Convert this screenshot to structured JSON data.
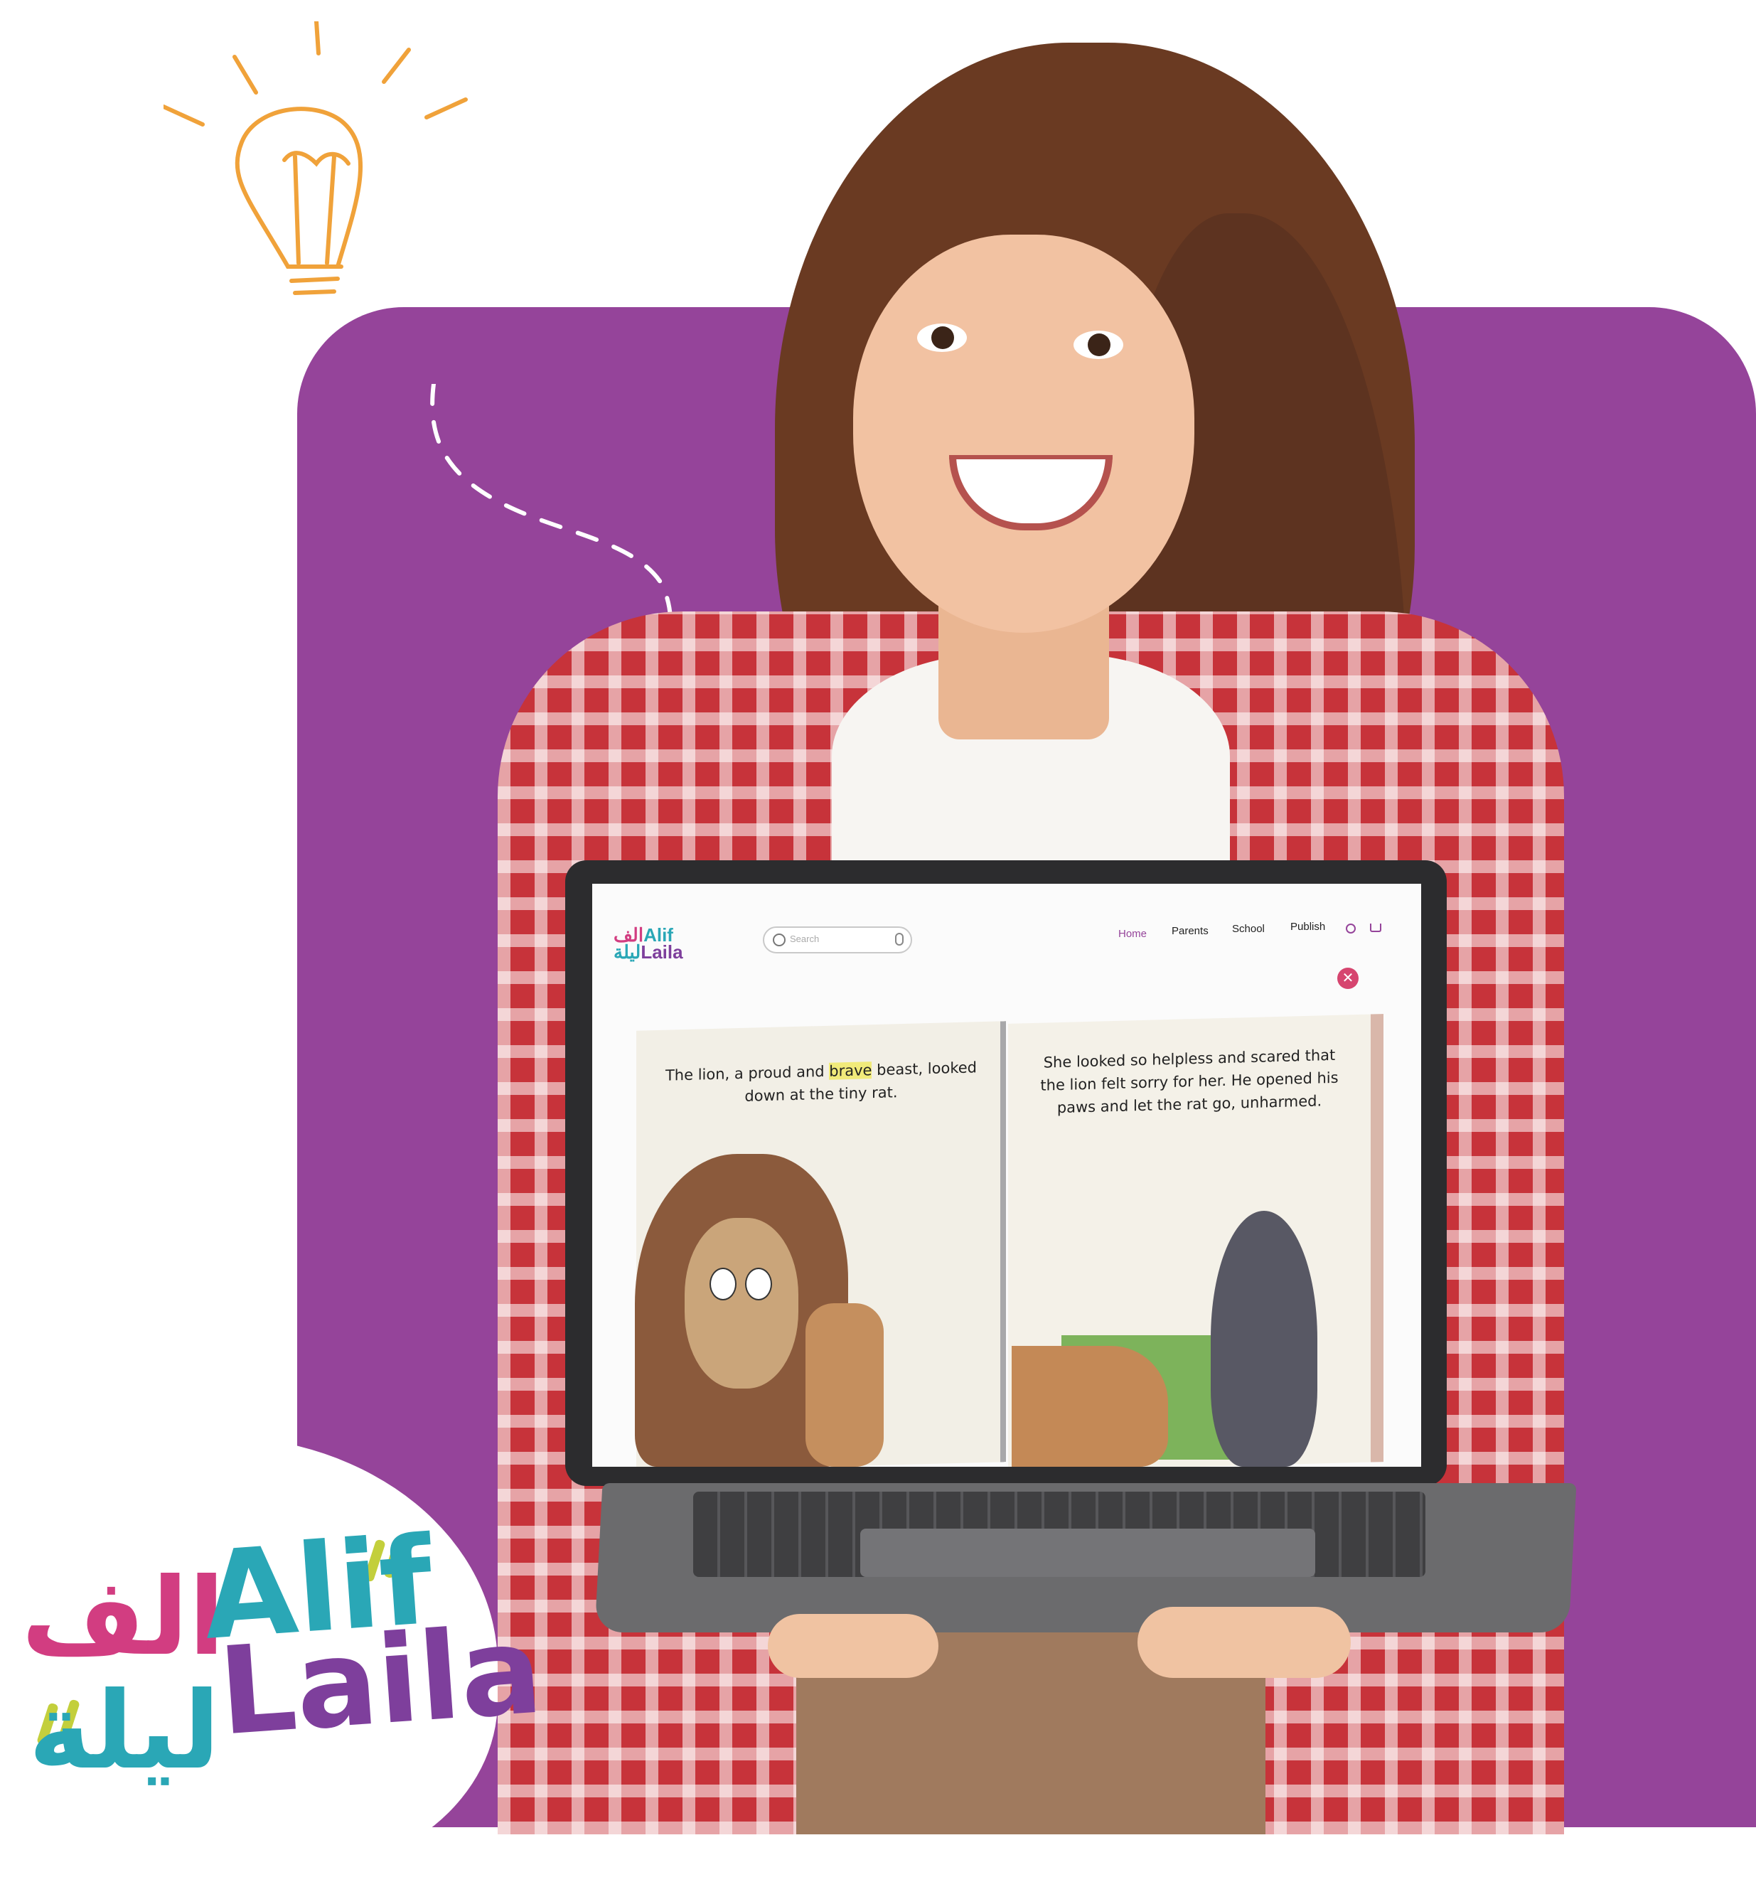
{
  "brand": {
    "latin_line1": "Alif",
    "latin_line2": "Laila",
    "arabic_line1": "الف",
    "arabic_line2": "ليلة",
    "colors": {
      "purple": "#95449a",
      "pink": "#d23d81",
      "teal": "#2aa7b6",
      "lime": "#c3cf3c"
    }
  },
  "screen": {
    "logo": {
      "arabic": "الف",
      "latin1": "Alif",
      "latin2": "Laila",
      "arabic2": "ليلة"
    },
    "search": {
      "placeholder": "Search",
      "icon": "search-icon",
      "mic_icon": "microphone-icon"
    },
    "nav": [
      "Home",
      "Parents",
      "School",
      "Publish"
    ],
    "nav_active": "Home",
    "icons": [
      "user-icon",
      "cart-icon",
      "close-icon"
    ],
    "book": {
      "left_page": {
        "pre": "The lion, a proud and ",
        "highlight": "brave",
        "post": " beast, looked down at the tiny rat."
      },
      "right_page": "She looked so helpless and scared that the lion felt sorry for her. He opened his paws and let the rat go, unharmed."
    }
  }
}
